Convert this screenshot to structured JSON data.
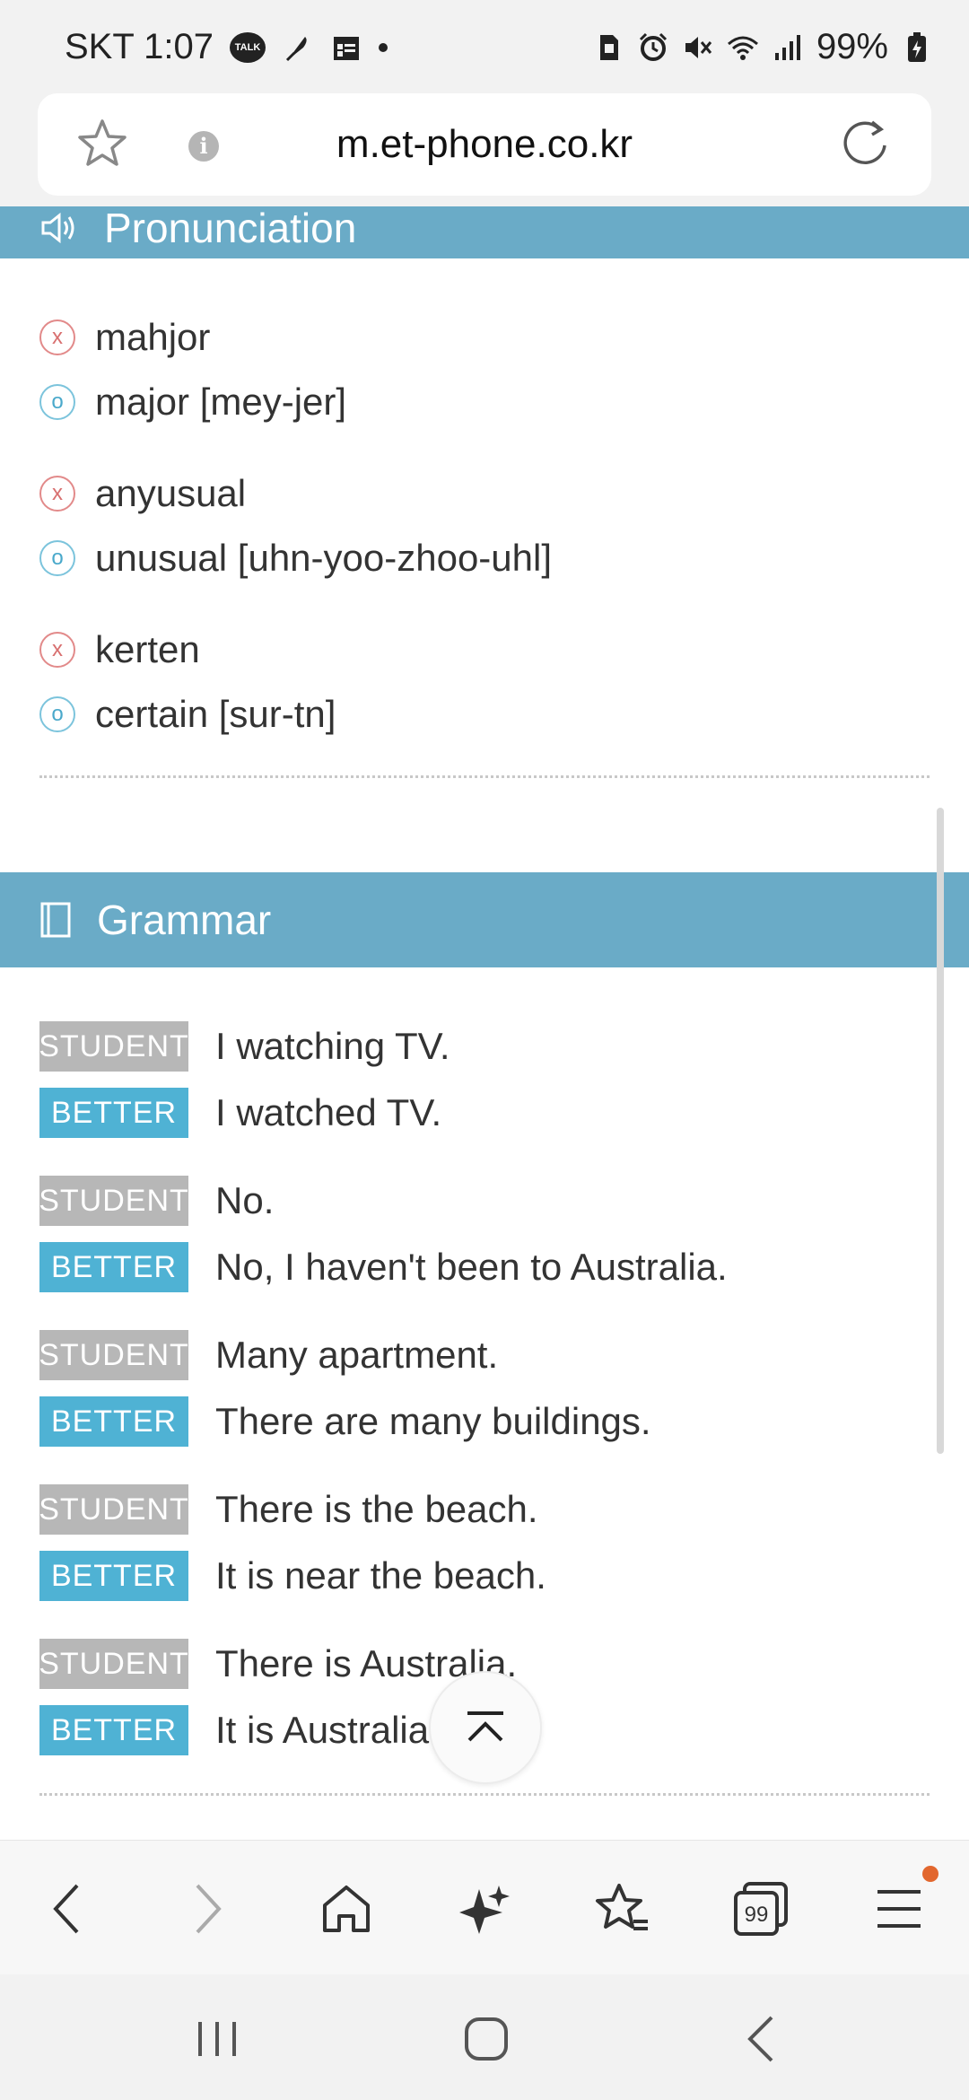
{
  "status_bar": {
    "carrier_time": "SKT 1:07",
    "talk_badge": "TALK",
    "battery": "99%",
    "icons": [
      "kakaotalk-icon",
      "feather-icon",
      "calendar-icon",
      "dot-icon",
      "sd-card-icon",
      "alarm-icon",
      "mute-icon",
      "wifi-icon",
      "signal-icon",
      "battery-icon"
    ]
  },
  "url_bar": {
    "url": "m.et-phone.co.kr",
    "info_glyph": "i"
  },
  "pronunciation": {
    "title": "Pronunciation",
    "icon": "speaker-icon",
    "pairs": [
      {
        "wrong": "mahjor",
        "right": "major [mey-jer]"
      },
      {
        "wrong": "anyusual",
        "right": "unusual [uhn-yoo-zhoo-uhl]"
      },
      {
        "wrong": "kerten",
        "right": "certain [sur-tn]"
      }
    ],
    "wrong_mark": "x",
    "right_mark": "o"
  },
  "grammar": {
    "title": "Grammar",
    "icon": "book-icon",
    "student_label": "STUDENT",
    "better_label": "BETTER",
    "pairs": [
      {
        "student": "I watching TV.",
        "better": "I watched TV."
      },
      {
        "student": "No.",
        "better": "No, I haven't been to Australia."
      },
      {
        "student": "Many apartment.",
        "better": "There are many buildings."
      },
      {
        "student": "There is the beach.",
        "better": "It is near the beach."
      },
      {
        "student": "There is Australia.",
        "better": "It is Australia."
      }
    ]
  },
  "colors": {
    "section_bar": "#6aabc7",
    "student_tag": "#b7b7b7",
    "better_tag": "#4fb2d4",
    "wrong_mark": "#d86f6f",
    "right_mark": "#4aa9cb",
    "notification": "#e2672e"
  },
  "toolbar": {
    "icons": [
      "back-icon",
      "forward-icon",
      "home-icon",
      "sparkle-icon",
      "bookmarks-icon",
      "tabs-icon",
      "menu-icon"
    ],
    "tabs_count": "99"
  },
  "nav_bar": {
    "icons": [
      "recents-icon",
      "home-circle-icon",
      "nav-back-icon"
    ]
  }
}
